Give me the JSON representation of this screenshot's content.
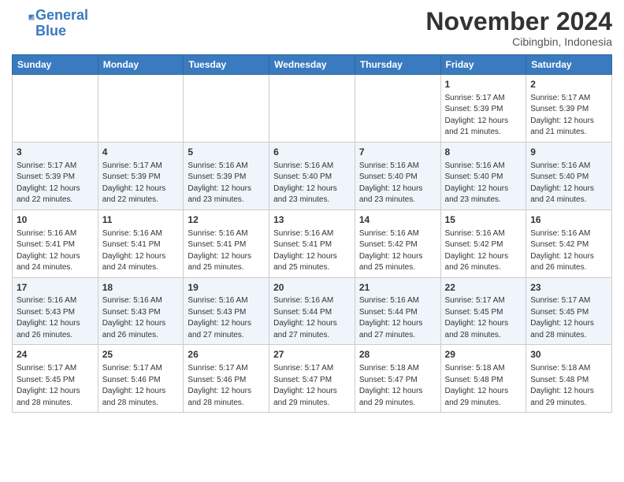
{
  "header": {
    "logo_line1": "General",
    "logo_line2": "Blue",
    "month": "November 2024",
    "location": "Cibingbin, Indonesia"
  },
  "weekdays": [
    "Sunday",
    "Monday",
    "Tuesday",
    "Wednesday",
    "Thursday",
    "Friday",
    "Saturday"
  ],
  "weeks": [
    [
      {
        "day": "",
        "info": ""
      },
      {
        "day": "",
        "info": ""
      },
      {
        "day": "",
        "info": ""
      },
      {
        "day": "",
        "info": ""
      },
      {
        "day": "",
        "info": ""
      },
      {
        "day": "1",
        "info": "Sunrise: 5:17 AM\nSunset: 5:39 PM\nDaylight: 12 hours\nand 21 minutes."
      },
      {
        "day": "2",
        "info": "Sunrise: 5:17 AM\nSunset: 5:39 PM\nDaylight: 12 hours\nand 21 minutes."
      }
    ],
    [
      {
        "day": "3",
        "info": "Sunrise: 5:17 AM\nSunset: 5:39 PM\nDaylight: 12 hours\nand 22 minutes."
      },
      {
        "day": "4",
        "info": "Sunrise: 5:17 AM\nSunset: 5:39 PM\nDaylight: 12 hours\nand 22 minutes."
      },
      {
        "day": "5",
        "info": "Sunrise: 5:16 AM\nSunset: 5:39 PM\nDaylight: 12 hours\nand 23 minutes."
      },
      {
        "day": "6",
        "info": "Sunrise: 5:16 AM\nSunset: 5:40 PM\nDaylight: 12 hours\nand 23 minutes."
      },
      {
        "day": "7",
        "info": "Sunrise: 5:16 AM\nSunset: 5:40 PM\nDaylight: 12 hours\nand 23 minutes."
      },
      {
        "day": "8",
        "info": "Sunrise: 5:16 AM\nSunset: 5:40 PM\nDaylight: 12 hours\nand 23 minutes."
      },
      {
        "day": "9",
        "info": "Sunrise: 5:16 AM\nSunset: 5:40 PM\nDaylight: 12 hours\nand 24 minutes."
      }
    ],
    [
      {
        "day": "10",
        "info": "Sunrise: 5:16 AM\nSunset: 5:41 PM\nDaylight: 12 hours\nand 24 minutes."
      },
      {
        "day": "11",
        "info": "Sunrise: 5:16 AM\nSunset: 5:41 PM\nDaylight: 12 hours\nand 24 minutes."
      },
      {
        "day": "12",
        "info": "Sunrise: 5:16 AM\nSunset: 5:41 PM\nDaylight: 12 hours\nand 25 minutes."
      },
      {
        "day": "13",
        "info": "Sunrise: 5:16 AM\nSunset: 5:41 PM\nDaylight: 12 hours\nand 25 minutes."
      },
      {
        "day": "14",
        "info": "Sunrise: 5:16 AM\nSunset: 5:42 PM\nDaylight: 12 hours\nand 25 minutes."
      },
      {
        "day": "15",
        "info": "Sunrise: 5:16 AM\nSunset: 5:42 PM\nDaylight: 12 hours\nand 26 minutes."
      },
      {
        "day": "16",
        "info": "Sunrise: 5:16 AM\nSunset: 5:42 PM\nDaylight: 12 hours\nand 26 minutes."
      }
    ],
    [
      {
        "day": "17",
        "info": "Sunrise: 5:16 AM\nSunset: 5:43 PM\nDaylight: 12 hours\nand 26 minutes."
      },
      {
        "day": "18",
        "info": "Sunrise: 5:16 AM\nSunset: 5:43 PM\nDaylight: 12 hours\nand 26 minutes."
      },
      {
        "day": "19",
        "info": "Sunrise: 5:16 AM\nSunset: 5:43 PM\nDaylight: 12 hours\nand 27 minutes."
      },
      {
        "day": "20",
        "info": "Sunrise: 5:16 AM\nSunset: 5:44 PM\nDaylight: 12 hours\nand 27 minutes."
      },
      {
        "day": "21",
        "info": "Sunrise: 5:16 AM\nSunset: 5:44 PM\nDaylight: 12 hours\nand 27 minutes."
      },
      {
        "day": "22",
        "info": "Sunrise: 5:17 AM\nSunset: 5:45 PM\nDaylight: 12 hours\nand 28 minutes."
      },
      {
        "day": "23",
        "info": "Sunrise: 5:17 AM\nSunset: 5:45 PM\nDaylight: 12 hours\nand 28 minutes."
      }
    ],
    [
      {
        "day": "24",
        "info": "Sunrise: 5:17 AM\nSunset: 5:45 PM\nDaylight: 12 hours\nand 28 minutes."
      },
      {
        "day": "25",
        "info": "Sunrise: 5:17 AM\nSunset: 5:46 PM\nDaylight: 12 hours\nand 28 minutes."
      },
      {
        "day": "26",
        "info": "Sunrise: 5:17 AM\nSunset: 5:46 PM\nDaylight: 12 hours\nand 28 minutes."
      },
      {
        "day": "27",
        "info": "Sunrise: 5:17 AM\nSunset: 5:47 PM\nDaylight: 12 hours\nand 29 minutes."
      },
      {
        "day": "28",
        "info": "Sunrise: 5:18 AM\nSunset: 5:47 PM\nDaylight: 12 hours\nand 29 minutes."
      },
      {
        "day": "29",
        "info": "Sunrise: 5:18 AM\nSunset: 5:48 PM\nDaylight: 12 hours\nand 29 minutes."
      },
      {
        "day": "30",
        "info": "Sunrise: 5:18 AM\nSunset: 5:48 PM\nDaylight: 12 hours\nand 29 minutes."
      }
    ]
  ]
}
